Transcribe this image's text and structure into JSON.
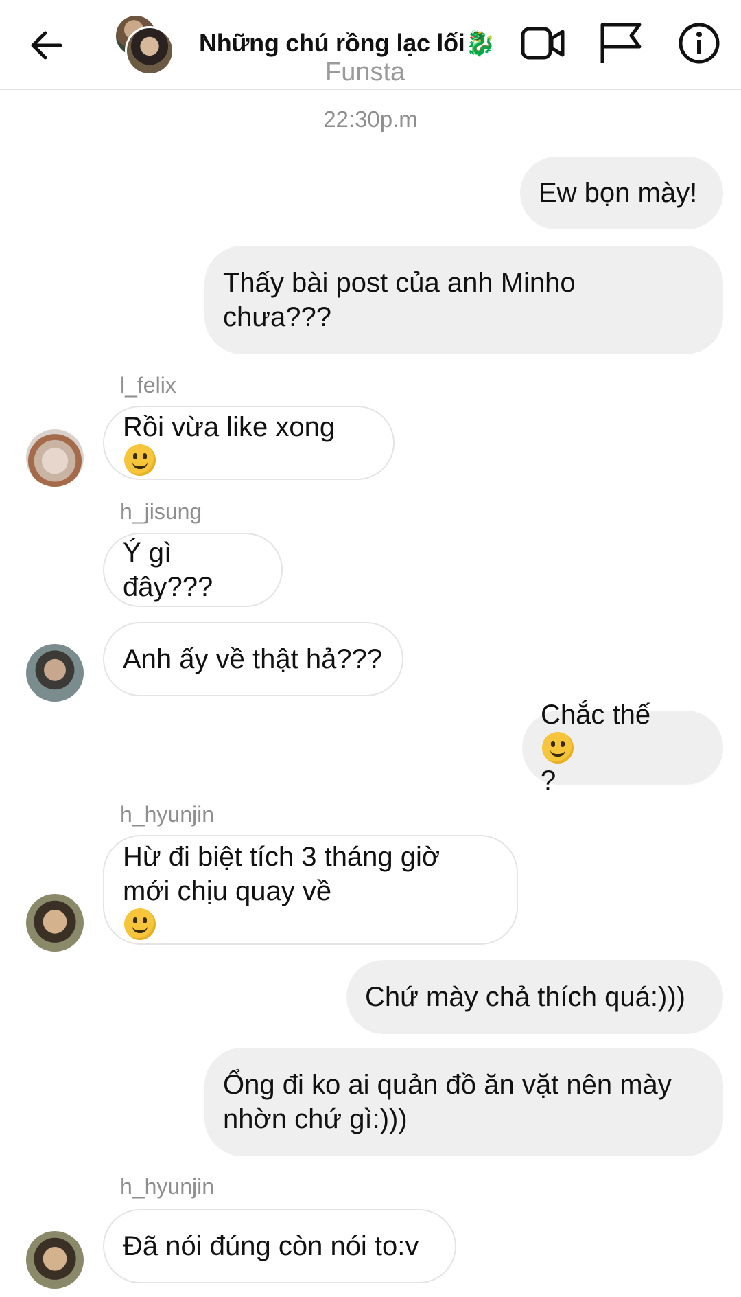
{
  "header": {
    "title": "Những chú rồng lạc lối🐉",
    "subtitle": "Funsta",
    "icons": [
      "back-arrow-icon",
      "video-call-icon",
      "flag-icon",
      "info-icon"
    ]
  },
  "chat": {
    "timestamp": "22:30p.m",
    "messages": [
      {
        "id": "m1",
        "direction": "out",
        "text": "Ew bọn mày!"
      },
      {
        "id": "m2",
        "direction": "out",
        "line1": "Thấy bài post của anh Minho",
        "line2": "chưa???"
      },
      {
        "id": "m3",
        "direction": "in",
        "sender": "l_felix",
        "text": "Rồi vừa like xong",
        "emoji": "smiling-face"
      },
      {
        "id": "m4",
        "direction": "in",
        "sender": "h_jisung",
        "text": "Ý gì đây???"
      },
      {
        "id": "m5",
        "direction": "in",
        "text": "Anh ấy về thật hả???"
      },
      {
        "id": "m6",
        "direction": "out",
        "text_before": "Chắc thế",
        "emoji": "grinning-face",
        "text_after": "?"
      },
      {
        "id": "m7",
        "direction": "in",
        "sender": "h_hyunjin",
        "line1": "Hừ đi biệt tích 3 tháng giờ",
        "line2": "mới chịu quay về",
        "emoji": "smirking-face"
      },
      {
        "id": "m8",
        "direction": "out",
        "text": "Chứ mày chả thích quá:)))"
      },
      {
        "id": "m9",
        "direction": "out",
        "line1": "Ổng đi ko ai quản đồ ăn vặt nên mày",
        "line2": "nhờn chứ gì:)))"
      },
      {
        "id": "m10",
        "direction": "in",
        "sender": "h_hyunjin",
        "text": "Đã nói đúng còn nói to:v"
      }
    ]
  },
  "colors": {
    "outgoing_bubble": "#efefef",
    "incoming_border": "#e4e4e4",
    "meta_text": "#8e8e8e",
    "emoji_yellow": "#f7c53b"
  }
}
